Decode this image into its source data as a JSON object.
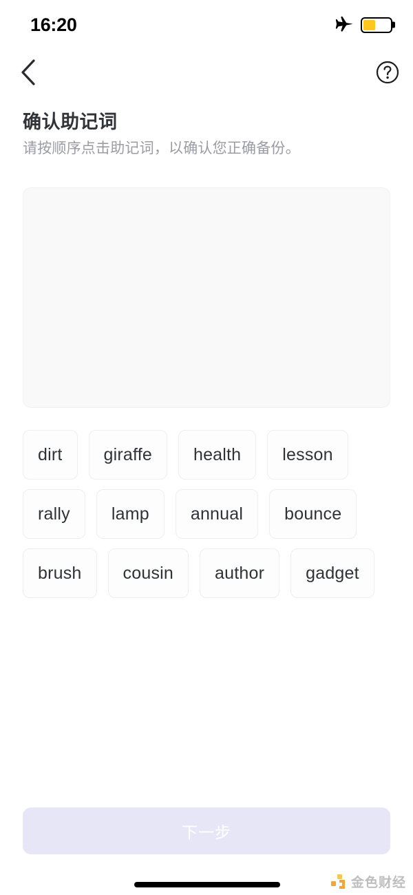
{
  "status_bar": {
    "time": "16:20",
    "airplane_icon": "airplane-mode-icon",
    "battery_icon": "battery-icon",
    "battery_level_percent": 45,
    "battery_color": "#ffc71e"
  },
  "nav": {
    "back_icon": "chevron-left-icon",
    "help_icon": "question-circle-icon"
  },
  "header": {
    "title": "确认助记词",
    "subtitle": "请按顺序点击助记词，以确认您正确备份。"
  },
  "answer_area": {
    "selected_words": [],
    "background_color": "#f9f9f9"
  },
  "word_pool": {
    "words": [
      "dirt",
      "giraffe",
      "health",
      "lesson",
      "rally",
      "lamp",
      "annual",
      "bounce",
      "brush",
      "cousin",
      "author",
      "gadget"
    ]
  },
  "footer": {
    "next_label": "下一步",
    "next_enabled": false,
    "next_bg_color": "#e7e6f6",
    "next_text_color": "#ffffff"
  },
  "watermark": {
    "text": "金色财经",
    "logo_icon": "jinse-logo-icon",
    "logo_color": "#f0a021"
  }
}
